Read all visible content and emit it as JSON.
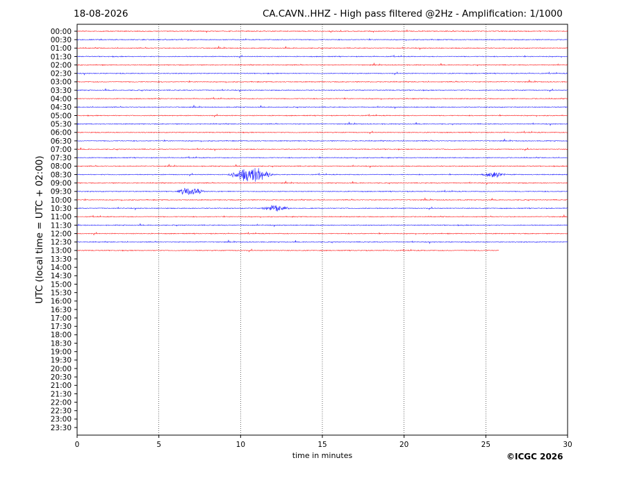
{
  "header": {
    "date": "18-08-2026",
    "title": "CA.CAVN..HHZ - High pass filtered @2Hz - Amplification: 1/1000"
  },
  "footer": {
    "copyright": "©ICGC 2026"
  },
  "chart_data": {
    "type": "line",
    "title": "CA.CAVN..HHZ - High pass filtered @2Hz - Amplification: 1/1000",
    "xlabel": "time in minutes",
    "ylabel": "UTC (local time = UTC + 02:00)",
    "xlim": [
      0,
      30
    ],
    "xticks": [
      0,
      5,
      10,
      15,
      20,
      25,
      30
    ],
    "grid": "vertical-dotted",
    "row_labels": [
      "00:00",
      "00:30",
      "01:00",
      "01:30",
      "02:00",
      "02:30",
      "03:00",
      "03:30",
      "04:00",
      "04:30",
      "05:00",
      "05:30",
      "06:00",
      "06:30",
      "07:00",
      "07:30",
      "08:00",
      "08:30",
      "09:00",
      "09:30",
      "10:00",
      "10:30",
      "11:00",
      "11:30",
      "12:00",
      "12:30",
      "13:00",
      "13:30",
      "14:00",
      "14:30",
      "15:00",
      "15:30",
      "16:00",
      "16:30",
      "17:00",
      "17:30",
      "18:00",
      "18:30",
      "19:00",
      "19:30",
      "20:00",
      "20:30",
      "21:00",
      "21:30",
      "22:00",
      "22:30",
      "23:00",
      "23:30"
    ],
    "trace_colors": [
      "#ff0000",
      "#0000ff"
    ],
    "recorded_rows": 27,
    "last_row_end_minute": 25.8,
    "events": [
      {
        "row": "08:30",
        "start": 9.2,
        "end": 13.8,
        "amplitude": 0.75
      },
      {
        "row": "08:30",
        "start": 24.7,
        "end": 27.2,
        "amplitude": 0.25
      },
      {
        "row": "09:30",
        "start": 6.0,
        "end": 9.0,
        "amplitude": 0.35
      },
      {
        "row": "10:30",
        "start": 11.2,
        "end": 14.2,
        "amplitude": 0.28
      }
    ]
  }
}
